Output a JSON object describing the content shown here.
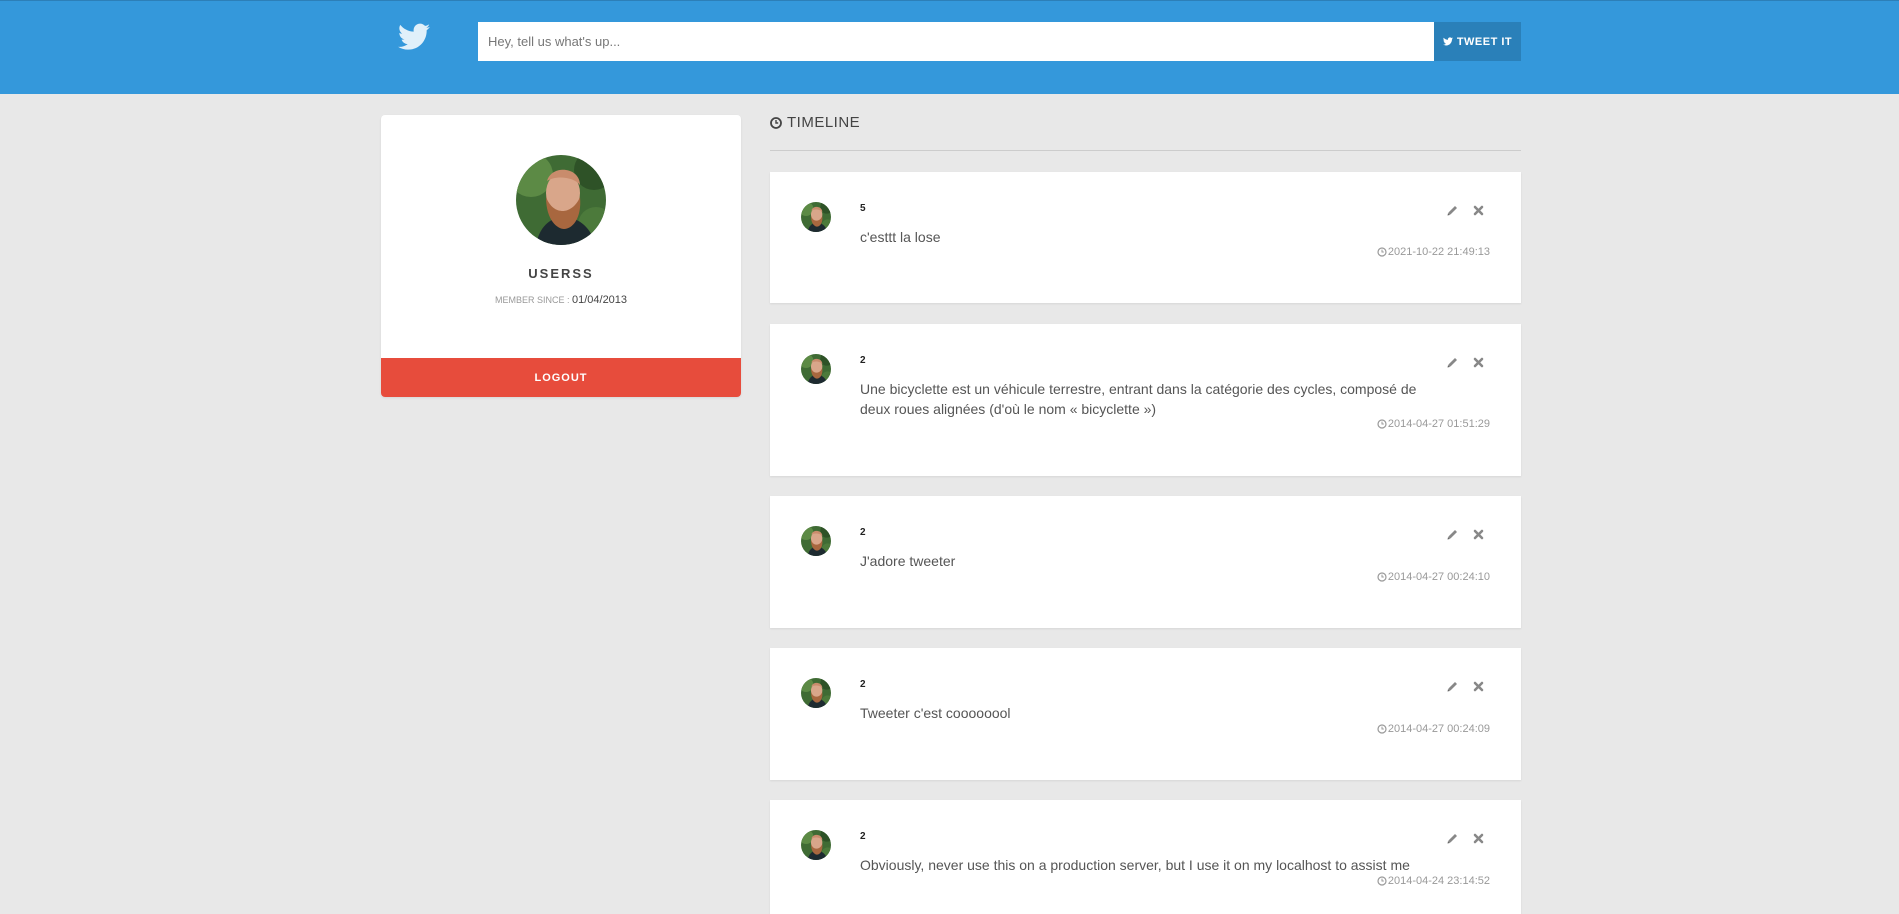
{
  "header": {
    "logo_icon": "twitter-bird-icon",
    "compose_placeholder": "Hey, tell us what's up...",
    "compose_value": "",
    "tweet_button_label": "TWEET IT",
    "brand_color": "#3498db"
  },
  "profile": {
    "avatar_icon": "user-avatar",
    "username": "USERSS",
    "member_since_label": "MEMBER SINCE :",
    "member_since_date": "01/04/2013",
    "logout_label": "LOGOUT"
  },
  "timeline": {
    "title": "TIMELINE",
    "title_icon": "clock-icon",
    "tweets": [
      {
        "author": "5",
        "text": "c'esttt la lose",
        "date": "2021-10-22 21:49:13",
        "edit_icon": "pencil-icon",
        "delete_icon": "close-icon"
      },
      {
        "author": "2",
        "text": "Une bicyclette est un véhicule terrestre, entrant dans la catégorie des cycles, composé de deux roues alignées (d'où le nom « bicyclette »)",
        "date": "2014-04-27 01:51:29",
        "edit_icon": "pencil-icon",
        "delete_icon": "close-icon"
      },
      {
        "author": "2",
        "text": "J'adore tweeter",
        "date": "2014-04-27 00:24:10",
        "edit_icon": "pencil-icon",
        "delete_icon": "close-icon"
      },
      {
        "author": "2",
        "text": "Tweeter c'est coooooool",
        "date": "2014-04-27 00:24:09",
        "edit_icon": "pencil-icon",
        "delete_icon": "close-icon"
      },
      {
        "author": "2",
        "text": "Obviously, never use this on a production server, but I use it on my localhost to assist me",
        "date": "2014-04-24 23:14:52",
        "edit_icon": "pencil-icon",
        "delete_icon": "close-icon"
      }
    ]
  },
  "colors": {
    "accent": "#3498db",
    "accent_dark": "#2a80b9",
    "danger": "#e74c3c",
    "background": "#e8e8e8"
  }
}
